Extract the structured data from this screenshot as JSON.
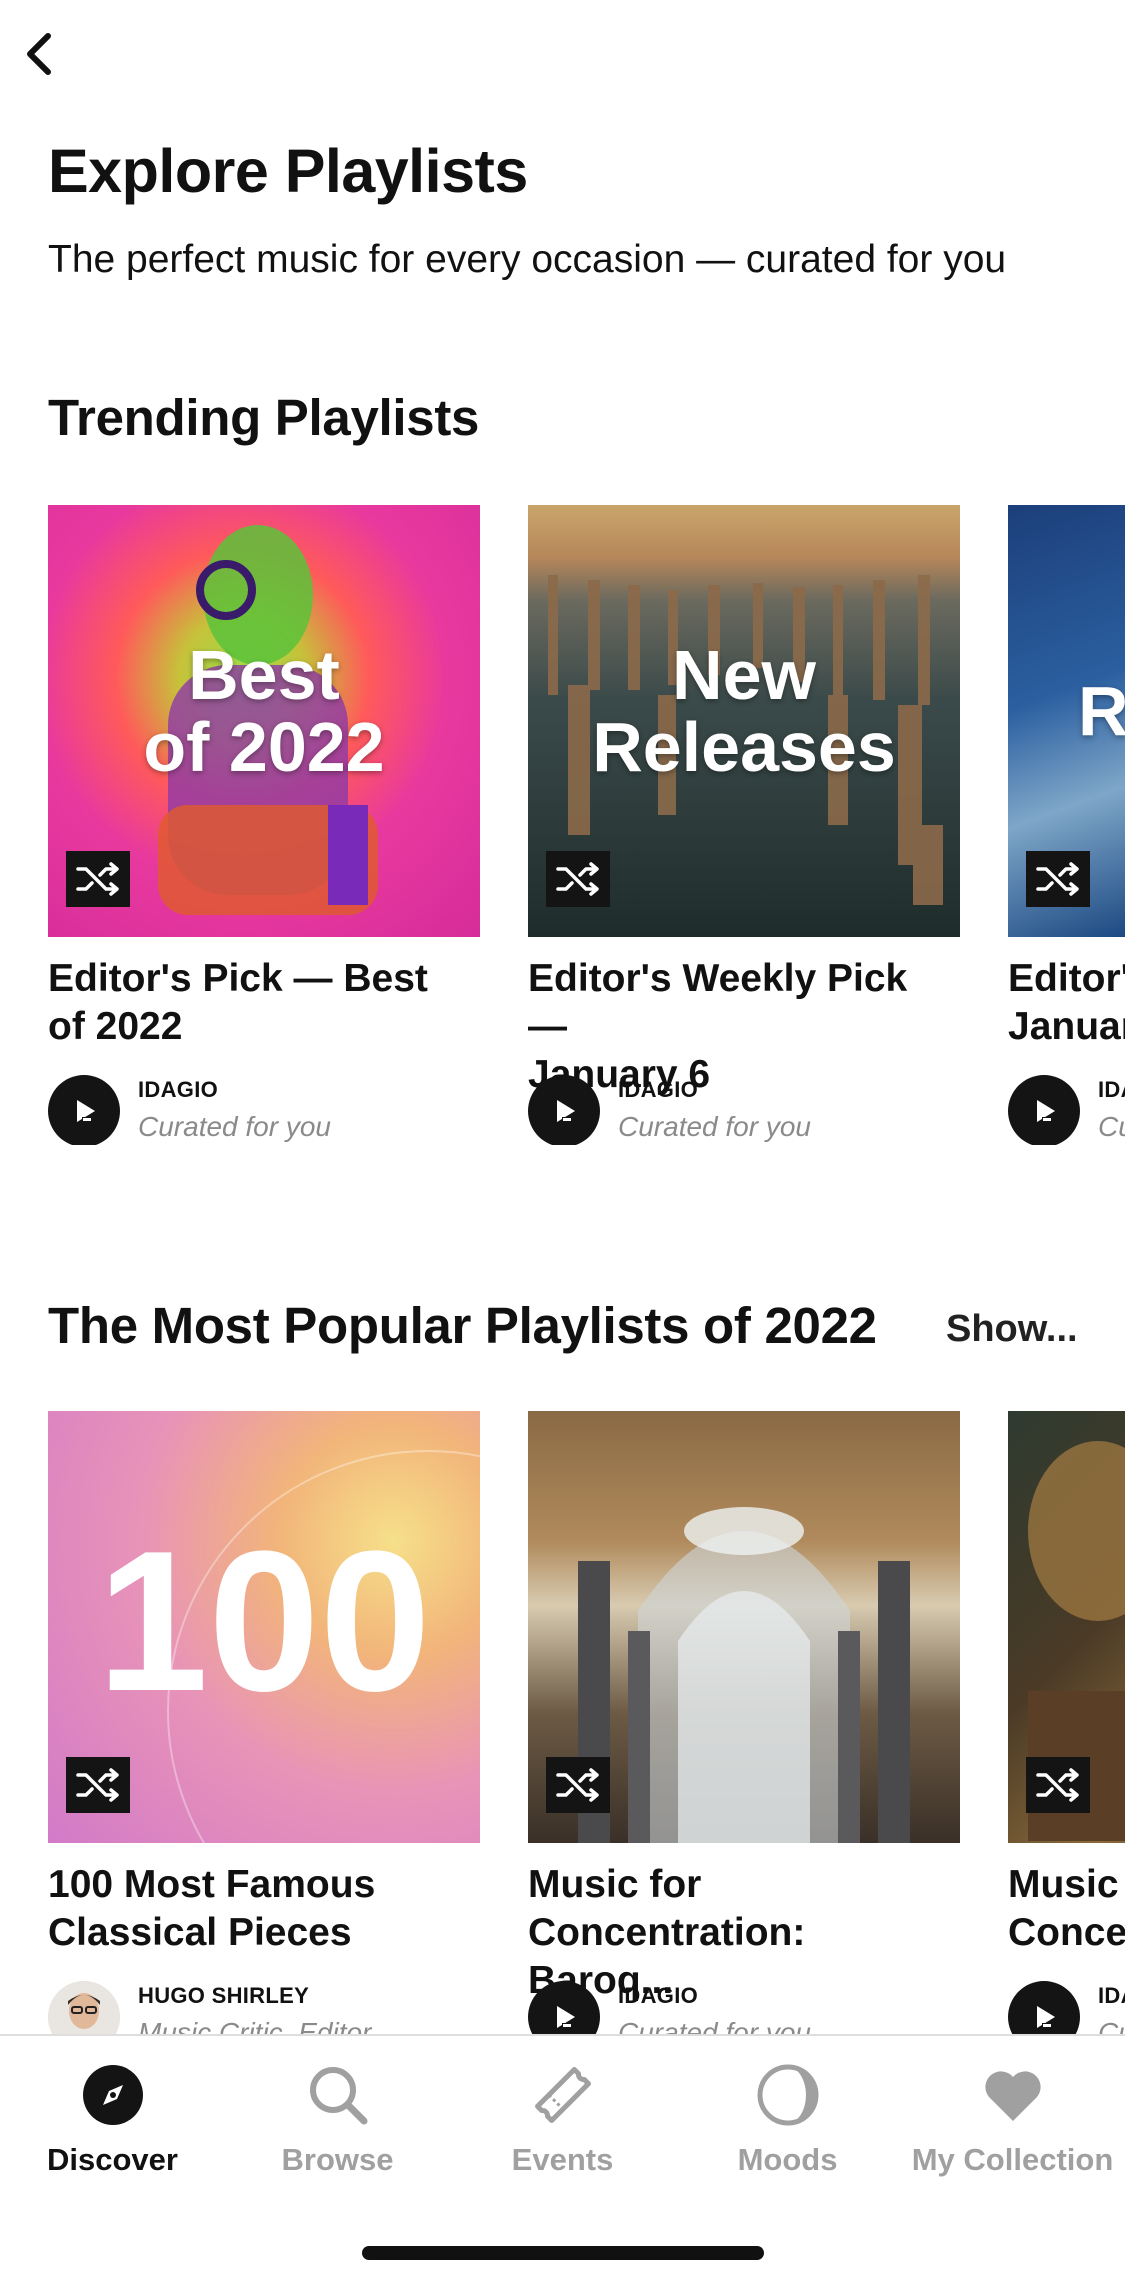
{
  "header": {
    "title": "Explore Playlists",
    "subtitle": "The perfect music for every occasion — curated for you"
  },
  "trending": {
    "title": "Trending Playlists",
    "cards": [
      {
        "art_text": "Best\nof 2022",
        "title": "Editor's Pick — Best\nof 2022",
        "curator": "IDAGIO",
        "curator_sub": "Curated for you"
      },
      {
        "art_text": "New\nReleases",
        "title": "Editor's Weekly Pick —\nJanuary 6",
        "curator": "IDAGIO",
        "curator_sub": "Curated for you"
      },
      {
        "art_text": "Re",
        "title": "Editor's\nJanuar",
        "curator": "IDA",
        "curator_sub": "Cu"
      }
    ]
  },
  "popular": {
    "title": "The Most Popular Playlists of 2022",
    "show_all": "Show...",
    "cards": [
      {
        "art_text": "100",
        "title": "100 Most Famous\nClassical Pieces",
        "curator": "HUGO SHIRLEY",
        "curator_sub": "Music Critic, Editor"
      },
      {
        "art_text": "",
        "title": "Music for\nConcentration: Baroq...",
        "curator": "IDAGIO",
        "curator_sub": "Curated for you"
      },
      {
        "art_text": "",
        "title": "Music\nConcer",
        "curator": "IDA",
        "curator_sub": "Cu"
      }
    ]
  },
  "tabs": [
    {
      "label": "Discover",
      "icon": "compass-icon",
      "active": true
    },
    {
      "label": "Browse",
      "icon": "search-icon",
      "active": false
    },
    {
      "label": "Events",
      "icon": "ticket-icon",
      "active": false
    },
    {
      "label": "Moods",
      "icon": "moon-icon",
      "active": false
    },
    {
      "label": "My Collection",
      "icon": "heart-icon",
      "active": false
    }
  ],
  "colors": {
    "accent_dark": "#141414",
    "inactive_tab": "#a0a0a0",
    "secondary_text": "#8a8a8a"
  }
}
